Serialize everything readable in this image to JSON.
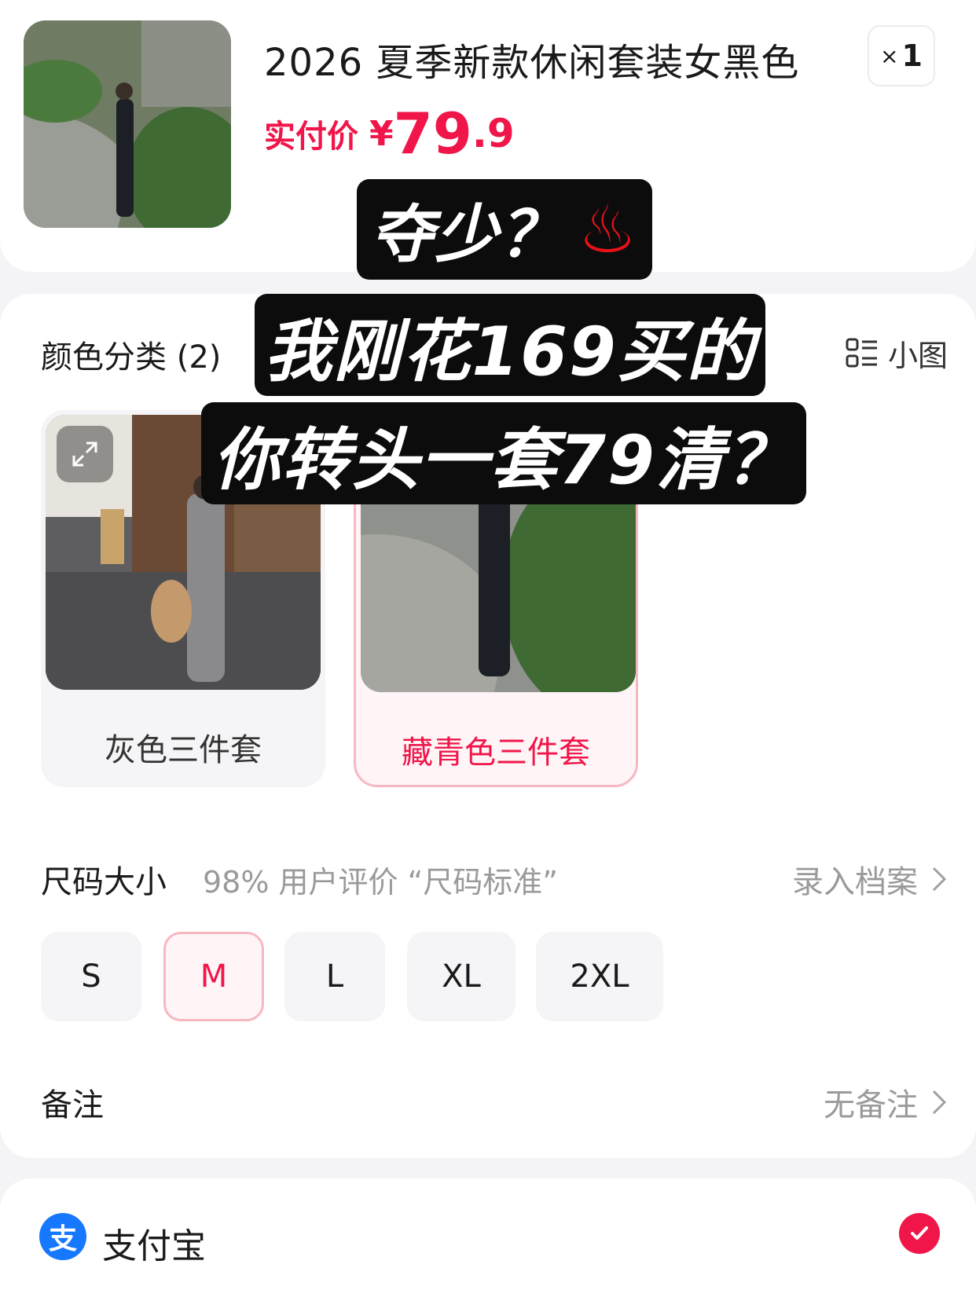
{
  "product": {
    "title": "2026 夏季新款休闲套装女黑色",
    "price_label": "实付价",
    "price_symbol": "¥",
    "price_integer": "79",
    "price_decimal": ".9",
    "quantity_prefix": "×",
    "quantity": "1"
  },
  "color": {
    "title": "颜色分类 (2)",
    "view_toggle_label": "小图",
    "view_icon": "list-view-icon",
    "options": [
      {
        "label": "灰色三件套",
        "selected": false
      },
      {
        "label": "藏青色三件套",
        "selected": true
      }
    ]
  },
  "size": {
    "title": "尺码大小",
    "subtitle": "98% 用户评价 “尺码标准”",
    "profile_link": "录入档案",
    "options": [
      {
        "label": "S",
        "selected": false
      },
      {
        "label": "M",
        "selected": true
      },
      {
        "label": "L",
        "selected": false
      },
      {
        "label": "XL",
        "selected": false
      },
      {
        "label": "2XL",
        "selected": false
      }
    ]
  },
  "remark": {
    "title": "备注",
    "value": "无备注"
  },
  "payment": {
    "logo_glyph": "支",
    "method": "支付宝"
  },
  "overlay": {
    "line1": "夺少？",
    "line1_emoji": "♨",
    "line2": "我刚花169买的",
    "line3": "你转头一套79清？"
  },
  "colors": {
    "accent": "#f0164a",
    "selected_border": "#f7b7c1",
    "alipay_blue": "#1677ff"
  }
}
